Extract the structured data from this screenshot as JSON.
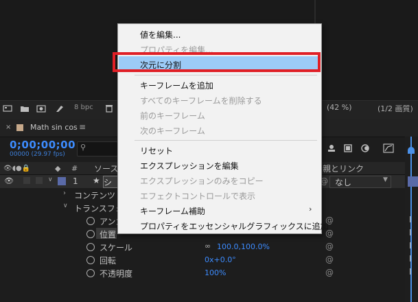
{
  "toolbar": {
    "bpc": "8 bpc",
    "zoom": "(42 %)",
    "quality": "(1/2 画質)"
  },
  "tab": {
    "close": "×",
    "title": "Math sin cos",
    "menu": "≡"
  },
  "timecode": {
    "time": "0;00;00;00",
    "frames": "00000 (29.97 fps)"
  },
  "columns": {
    "source": "ソース",
    "parent": "親とリンク"
  },
  "layer": {
    "number": "1",
    "name": "シ",
    "parent_value": "なし"
  },
  "tree": {
    "contents": "コンテンツ",
    "transform": "トランスフォ",
    "anchor": "アンカ",
    "position": "位置",
    "scale": "スケール",
    "scale_value": "100.0,100.0%",
    "rotation": "回転",
    "rotation_value": "0x+0.0°",
    "opacity": "不透明度",
    "opacity_value": "100%"
  },
  "menu": {
    "edit_value": "値を編集...",
    "edit_property": "プロパティを編集...",
    "separate_dimensions": "次元に分割",
    "add_keyframe": "キーフレームを追加",
    "delete_all_keyframes": "すべてのキーフレームを削除する",
    "prev_keyframe": "前のキーフレーム",
    "next_keyframe": "次のキーフレーム",
    "reset": "リセット",
    "edit_expression": "エクスプレッションを編集",
    "copy_expression_only": "エクスプレッションのみをコピー",
    "show_in_effect_controls": "エフェクトコントロールで表示",
    "keyframe_assistant": "キーフレーム補助",
    "add_to_essential_graphics": "プロパティをエッセンシャルグラフィックスに追加",
    "submenu_arrow": "›"
  },
  "colors": {
    "timecode": "#3d8cff",
    "menu_highlight": "#9ccbf7",
    "annotation_frame": "#e01f26"
  }
}
